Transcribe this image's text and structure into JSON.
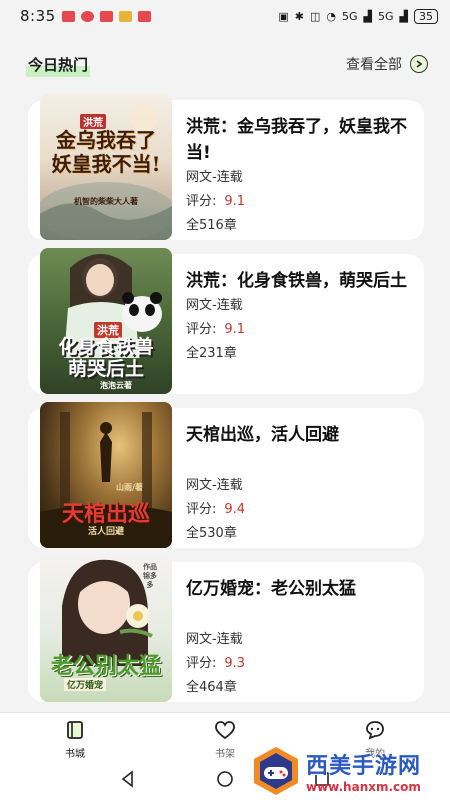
{
  "status_bar": {
    "time": "8:35",
    "network_label": "5G",
    "battery": "35",
    "notification_colors": [
      "#e5484d",
      "#e5484d",
      "#e8b339",
      "#e5484d",
      "#e5484d"
    ]
  },
  "section": {
    "title": "今日热门",
    "see_all": "查看全部"
  },
  "books": [
    {
      "title": "洪荒：金乌我吞了，妖皇我不当!",
      "category": "网文-连载",
      "score_label": "评分:",
      "score": "9.1",
      "chapters": "全516章",
      "cover_text": "金乌我吞了 妖皇我不当!",
      "cover_tag": "洪荒",
      "cover_author": "机智的柴柴大人著"
    },
    {
      "title": "洪荒：化身食铁兽，萌哭后土",
      "category": "网文-连载",
      "score_label": "评分:",
      "score": "9.1",
      "chapters": "全231章",
      "cover_text": "化身食铁兽 萌哭后土",
      "cover_tag": "洪荒",
      "cover_author": "泡泡云著"
    },
    {
      "title": "天棺出巡，活人回避",
      "category": "网文-连载",
      "score_label": "评分:",
      "score": "9.4",
      "chapters": "全530章",
      "cover_text": "天棺出巡",
      "cover_tag": "活人回避",
      "cover_author": "山雨/著"
    },
    {
      "title": "亿万婚宠：老公别太猛",
      "category": "网文-连载",
      "score_label": "评分:",
      "score": "9.3",
      "chapters": "全464章",
      "cover_text": "老公别太猛",
      "cover_tag": "亿万婚宠",
      "cover_author": "作品 锦多多"
    }
  ],
  "bottom_nav": [
    {
      "label": "书城",
      "icon": "book-icon",
      "active": true
    },
    {
      "label": "书架",
      "icon": "heart-icon",
      "active": false
    },
    {
      "label": "我的",
      "icon": "smile-icon",
      "active": false
    }
  ],
  "watermark": {
    "title": "西美手游网",
    "url": "www.hanxm.com"
  },
  "colors": {
    "accent": "#c8f0c0",
    "score": "#c0392b",
    "watermark_blue": "#2b59c3",
    "watermark_red": "#d6323f"
  }
}
